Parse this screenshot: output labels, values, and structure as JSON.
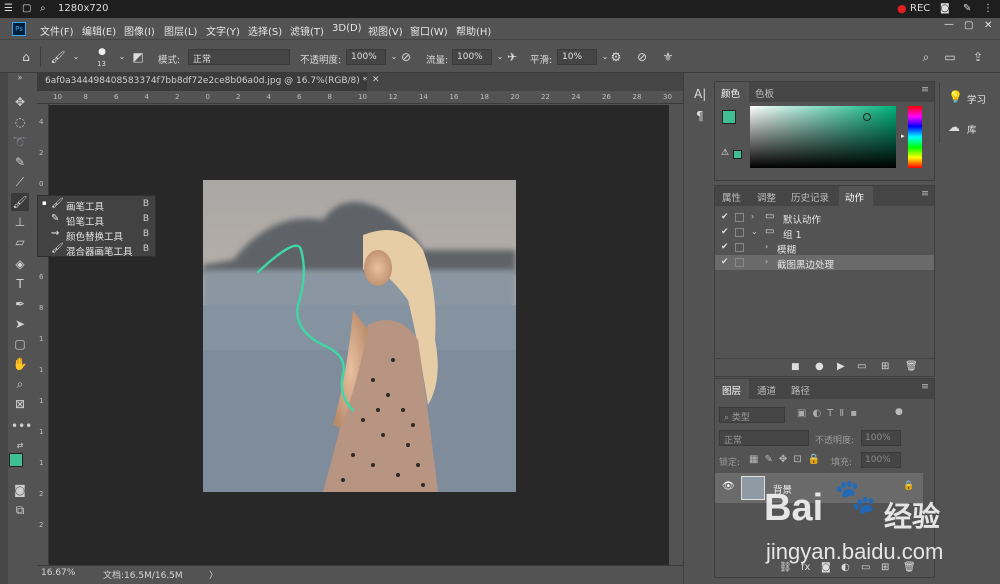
{
  "recorder": {
    "menu_icon": "hamburger-icon",
    "resolution": "1280x720",
    "rec_label": "REC",
    "status_color": "#e02020"
  },
  "menubar": {
    "app_logo": "Ps",
    "items": [
      "文件(F)",
      "编辑(E)",
      "图像(I)",
      "图层(L)",
      "文字(Y)",
      "选择(S)",
      "滤镜(T)",
      "3D(D)",
      "视图(V)",
      "窗口(W)",
      "帮助(H)"
    ]
  },
  "options": {
    "brush_size": "13",
    "mode_label": "模式:",
    "mode_value": "正常",
    "opacity_label": "不透明度:",
    "opacity_value": "100%",
    "flow_label": "流量:",
    "flow_value": "100%",
    "smooth_label": "平滑:",
    "smooth_value": "10%"
  },
  "document": {
    "tab_title": "6af0a344498408583374f7bb8df72e2ce8b06a0d.jpg @ 16.7%(RGB/8) *",
    "ruler_top": [
      "10",
      "8",
      "6",
      "4",
      "2",
      "0",
      "2",
      "4",
      "6",
      "8",
      "10",
      "12",
      "14",
      "16",
      "18",
      "20",
      "22",
      "24",
      "26",
      "28",
      "30",
      "32"
    ],
    "ruler_left": [
      "4",
      "2",
      "0",
      "2",
      "4",
      "6",
      "8",
      "1",
      "1",
      "1",
      "1",
      "1",
      "2",
      "2"
    ],
    "zoom": "16.67%",
    "doc_size": "文档:16.5M/16.5M"
  },
  "brush_popup": {
    "items": [
      {
        "label": "画笔工具",
        "key": "B",
        "active": true
      },
      {
        "label": "铅笔工具",
        "key": "B",
        "active": false
      },
      {
        "label": "颜色替换工具",
        "key": "B",
        "active": false
      },
      {
        "label": "混合器画笔工具",
        "key": "B",
        "active": false
      }
    ]
  },
  "color_panel": {
    "tabs": [
      "颜色",
      "色板"
    ],
    "fg_color": "#3fbf93",
    "bg_color": "#ffffff"
  },
  "actions_panel": {
    "tabs": [
      "属性",
      "调整",
      "历史记录",
      "动作"
    ],
    "rows": [
      {
        "label": "默认动作",
        "level": 0,
        "expanded": false
      },
      {
        "label": "组 1",
        "level": 0,
        "expanded": true
      },
      {
        "label": "模糊",
        "level": 1,
        "expanded": false
      },
      {
        "label": "截图黑边处理",
        "level": 1,
        "expanded": false,
        "selected": true
      }
    ]
  },
  "layers_panel": {
    "tabs": [
      "图层",
      "通道",
      "路径"
    ],
    "filter_kind": "类型",
    "blend_mode": "正常",
    "opacity_label": "不透明度:",
    "opacity_value": "100%",
    "lock_label": "锁定:",
    "fill_label": "填充:",
    "fill_value": "100%",
    "layer_name": "背景"
  },
  "right_strip": {
    "learn": "学习",
    "library": "库"
  },
  "watermark": {
    "brand": "Bai",
    "brand_cn": "经验",
    "url": "jingyan.baidu.com"
  }
}
